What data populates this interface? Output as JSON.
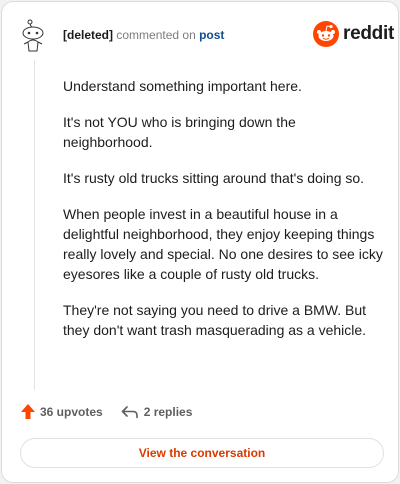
{
  "comment": {
    "author": "[deleted]",
    "action_text": "commented on",
    "post_link": "post",
    "paragraphs": [
      "Understand something important here.",
      "It's not YOU who is bringing down the neighborhood.",
      "It's rusty old trucks sitting around that's doing so.",
      "When people invest in a beautiful house in a delightful neighborhood, they enjoy keeping things really lovely and special. No one desires to see icky eyesores like a couple of rusty old trucks.",
      "They're not saying you need to drive a BMW. But they don't want trash masquerading as a vehicle."
    ]
  },
  "brand": {
    "wordmark": "reddit",
    "color": "#ff4500"
  },
  "stats": {
    "upvotes": "36 upvotes",
    "replies": "2 replies"
  },
  "cta": {
    "label": "View the conversation"
  },
  "icons": [
    "snoo-avatar-icon",
    "reddit-logo-icon",
    "upvote-arrow-icon",
    "reply-arrow-icon"
  ]
}
